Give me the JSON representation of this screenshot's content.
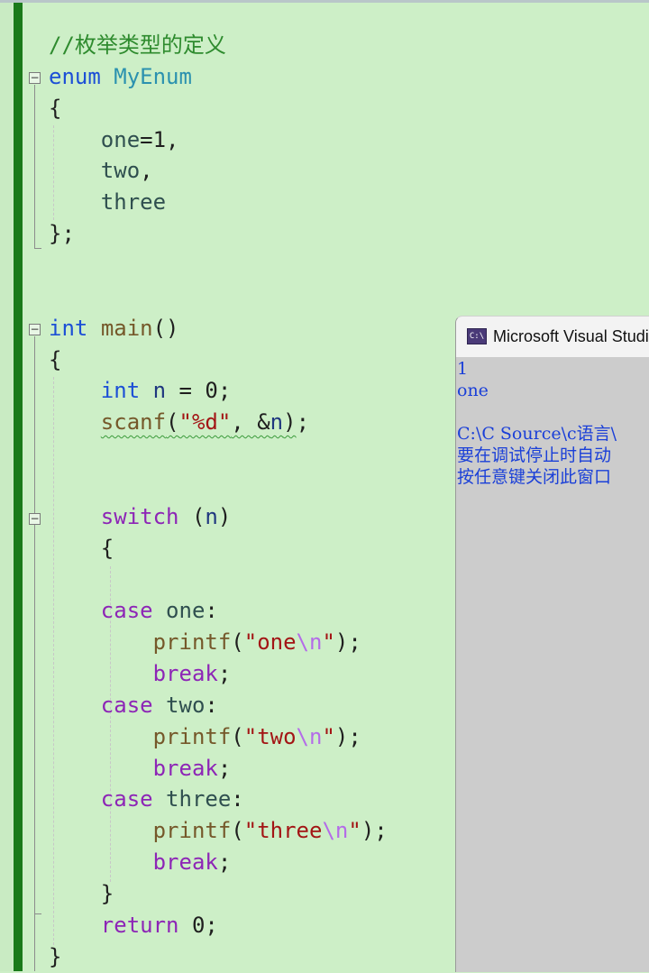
{
  "editor": {
    "lines": [
      [
        {
          "t": "//枚举类型的定义",
          "c": "comment"
        }
      ],
      [
        {
          "t": "enum",
          "c": "kw"
        },
        {
          "t": " ",
          "c": "punc"
        },
        {
          "t": "MyEnum",
          "c": "type"
        }
      ],
      [
        {
          "t": "{",
          "c": "punc"
        }
      ],
      [
        {
          "t": "    ",
          "c": "punc"
        },
        {
          "t": "one",
          "c": "enumv"
        },
        {
          "t": "=1,",
          "c": "punc"
        }
      ],
      [
        {
          "t": "    ",
          "c": "punc"
        },
        {
          "t": "two",
          "c": "enumv"
        },
        {
          "t": ",",
          "c": "punc"
        }
      ],
      [
        {
          "t": "    ",
          "c": "punc"
        },
        {
          "t": "three",
          "c": "enumv"
        }
      ],
      [
        {
          "t": "};",
          "c": "punc"
        }
      ],
      [],
      [],
      [
        {
          "t": "int",
          "c": "kw"
        },
        {
          "t": " ",
          "c": "punc"
        },
        {
          "t": "main",
          "c": "fn"
        },
        {
          "t": "()",
          "c": "punc"
        }
      ],
      [
        {
          "t": "{",
          "c": "punc"
        }
      ],
      [
        {
          "t": "    ",
          "c": "punc"
        },
        {
          "t": "int",
          "c": "kw"
        },
        {
          "t": " ",
          "c": "punc"
        },
        {
          "t": "n",
          "c": "var"
        },
        {
          "t": " = 0;",
          "c": "punc"
        }
      ],
      [
        {
          "t": "    ",
          "c": "punc"
        },
        {
          "t": "scanf",
          "c": "fn",
          "s": 1
        },
        {
          "t": "(",
          "c": "punc",
          "s": 1
        },
        {
          "t": "\"%d\"",
          "c": "str",
          "s": 1
        },
        {
          "t": ", &",
          "c": "punc",
          "s": 1
        },
        {
          "t": "n",
          "c": "var",
          "s": 1
        },
        {
          "t": ")",
          "c": "punc",
          "s": 1
        },
        {
          "t": ";",
          "c": "punc"
        }
      ],
      [],
      [],
      [
        {
          "t": "    ",
          "c": "punc"
        },
        {
          "t": "switch",
          "c": "kw2"
        },
        {
          "t": " (",
          "c": "punc"
        },
        {
          "t": "n",
          "c": "var"
        },
        {
          "t": ")",
          "c": "punc"
        }
      ],
      [
        {
          "t": "    {",
          "c": "punc"
        }
      ],
      [],
      [
        {
          "t": "    ",
          "c": "punc"
        },
        {
          "t": "case",
          "c": "kw2"
        },
        {
          "t": " ",
          "c": "punc"
        },
        {
          "t": "one",
          "c": "enumv"
        },
        {
          "t": ":",
          "c": "punc"
        }
      ],
      [
        {
          "t": "        ",
          "c": "punc"
        },
        {
          "t": "printf",
          "c": "fn"
        },
        {
          "t": "(",
          "c": "punc"
        },
        {
          "t": "\"one",
          "c": "str"
        },
        {
          "t": "\\n",
          "c": "esc"
        },
        {
          "t": "\"",
          "c": "str"
        },
        {
          "t": ");",
          "c": "punc"
        }
      ],
      [
        {
          "t": "        ",
          "c": "punc"
        },
        {
          "t": "break",
          "c": "kw2"
        },
        {
          "t": ";",
          "c": "punc"
        }
      ],
      [
        {
          "t": "    ",
          "c": "punc"
        },
        {
          "t": "case",
          "c": "kw2"
        },
        {
          "t": " ",
          "c": "punc"
        },
        {
          "t": "two",
          "c": "enumv"
        },
        {
          "t": ":",
          "c": "punc"
        }
      ],
      [
        {
          "t": "        ",
          "c": "punc"
        },
        {
          "t": "printf",
          "c": "fn"
        },
        {
          "t": "(",
          "c": "punc"
        },
        {
          "t": "\"two",
          "c": "str"
        },
        {
          "t": "\\n",
          "c": "esc"
        },
        {
          "t": "\"",
          "c": "str"
        },
        {
          "t": ");",
          "c": "punc"
        }
      ],
      [
        {
          "t": "        ",
          "c": "punc"
        },
        {
          "t": "break",
          "c": "kw2"
        },
        {
          "t": ";",
          "c": "punc"
        }
      ],
      [
        {
          "t": "    ",
          "c": "punc"
        },
        {
          "t": "case",
          "c": "kw2"
        },
        {
          "t": " ",
          "c": "punc"
        },
        {
          "t": "three",
          "c": "enumv"
        },
        {
          "t": ":",
          "c": "punc"
        }
      ],
      [
        {
          "t": "        ",
          "c": "punc"
        },
        {
          "t": "printf",
          "c": "fn"
        },
        {
          "t": "(",
          "c": "punc"
        },
        {
          "t": "\"three",
          "c": "str"
        },
        {
          "t": "\\n",
          "c": "esc"
        },
        {
          "t": "\"",
          "c": "str"
        },
        {
          "t": ");",
          "c": "punc"
        }
      ],
      [
        {
          "t": "        ",
          "c": "punc"
        },
        {
          "t": "break",
          "c": "kw2"
        },
        {
          "t": ";",
          "c": "punc"
        }
      ],
      [
        {
          "t": "    }",
          "c": "punc"
        }
      ],
      [
        {
          "t": "    ",
          "c": "punc"
        },
        {
          "t": "return",
          "c": "kw2"
        },
        {
          "t": " 0;",
          "c": "punc"
        }
      ],
      [
        {
          "t": "}",
          "c": "punc"
        }
      ]
    ],
    "fold_markers": [
      "⊟",
      "⊟",
      "⊟"
    ]
  },
  "console": {
    "title": "Microsoft Visual Studio",
    "icon_text": "C:\\",
    "lines": [
      "1",
      "one",
      "",
      "C:\\C Source\\c语言\\",
      "要在调试停止时自动",
      "按任意键关闭此窗口"
    ]
  }
}
